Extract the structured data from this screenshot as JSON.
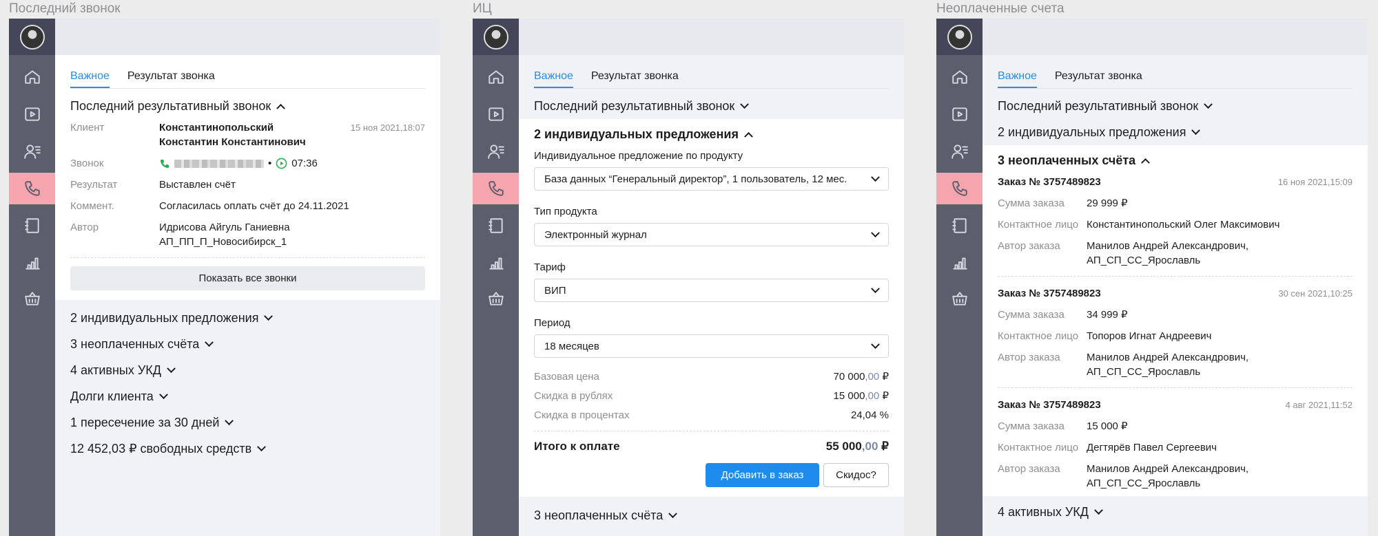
{
  "panels": [
    {
      "title": "Последний звонок"
    },
    {
      "title": "ИЦ"
    },
    {
      "title": "Неоплаченные счета"
    }
  ],
  "tabs": {
    "important": "Важное",
    "call_result": "Результат звонка"
  },
  "last_call": {
    "header": "Последний результативный звонок",
    "date": "15 ноя 2021,18:07",
    "client_label": "Клиент",
    "client_line1": "Константинопольский",
    "client_line2": "Константин Константинович",
    "call_label": "Звонок",
    "call_sep": "•",
    "call_duration": "07:36",
    "result_label": "Результат",
    "result_value": "Выставлен счёт",
    "comment_label": "Коммент.",
    "comment_value": "Согласилась оплать счёт до 24.11.2021",
    "author_label": "Автор",
    "author_line1": "Идрисова Айгуль Ганиевна",
    "author_line2": "АП_ПП_П_Новосибирск_1",
    "show_all_button": "Показать все звонки"
  },
  "sections": {
    "offers": "2 индивидуальных предложения",
    "unpaid": "3 неоплаченных счёта",
    "ukd": "4 активных УКД",
    "debts": "Долги клиента",
    "intersections": "1 пересечение за 30 дней",
    "free_funds": "12 452,03 ₽ свободных средств"
  },
  "offer_form": {
    "product_label": "Индивидуальное предложение по продукту",
    "product_value": "База данных “Генеральный директор”, 1 пользователь, 12 мес.",
    "type_label": "Тип продукта",
    "type_value": "Электронный журнал",
    "tariff_label": "Тариф",
    "tariff_value": "ВИП",
    "period_label": "Период",
    "period_value": "18 месяцев",
    "base_price_label": "Базовая цена",
    "base_price_int": "70 000",
    "base_price_cents": ",00",
    "discount_rub_label": "Скидка в рублях",
    "discount_rub_int": "15 000",
    "discount_rub_cents": ",00",
    "discount_pct_label": "Скидка в процентах",
    "discount_pct_value": "24,04 %",
    "total_label": "Итого к оплате",
    "total_int": "55 000",
    "total_cents": ",00",
    "currency": "₽",
    "add_button": "Добавить в заказ",
    "discount_button": "Скидос?"
  },
  "orders": [
    {
      "title": "Заказ № 3757489823",
      "date": "16 ноя 2021,15:09",
      "sum": "29 999 ₽",
      "contact": "Константинопольский Олег Максимович",
      "author1": "Манилов Андрей Александрович,",
      "author2": "АП_СП_СС_Ярославль"
    },
    {
      "title": "Заказ № 3757489823",
      "date": "30 сен 2021,10:25",
      "sum": "34 999 ₽",
      "contact": "Топоров Игнат Андреевич",
      "author1": "Манилов Андрей Александрович,",
      "author2": "АП_СП_СС_Ярославль"
    },
    {
      "title": "Заказ № 3757489823",
      "date": "4 авг 2021,11:52",
      "sum": "15 000 ₽",
      "contact": "Дегтярёв Павел Сергеевич",
      "author1": "Манилов Андрей Александрович,",
      "author2": "АП_СП_СС_Ярославль"
    }
  ],
  "order_labels": {
    "sum": "Сумма заказа",
    "contact": "Контактное лицо",
    "author": "Автор заказа"
  },
  "icons": [
    "home-icon",
    "play-icon",
    "contacts-icon",
    "phone-icon",
    "journal-icon",
    "chart-icon",
    "basket-icon"
  ],
  "colors": {
    "accent": "#2b8be5",
    "rail": "#5b5f6d",
    "active_nav": "#f6a4ad",
    "call_green": "#1fb14a"
  }
}
